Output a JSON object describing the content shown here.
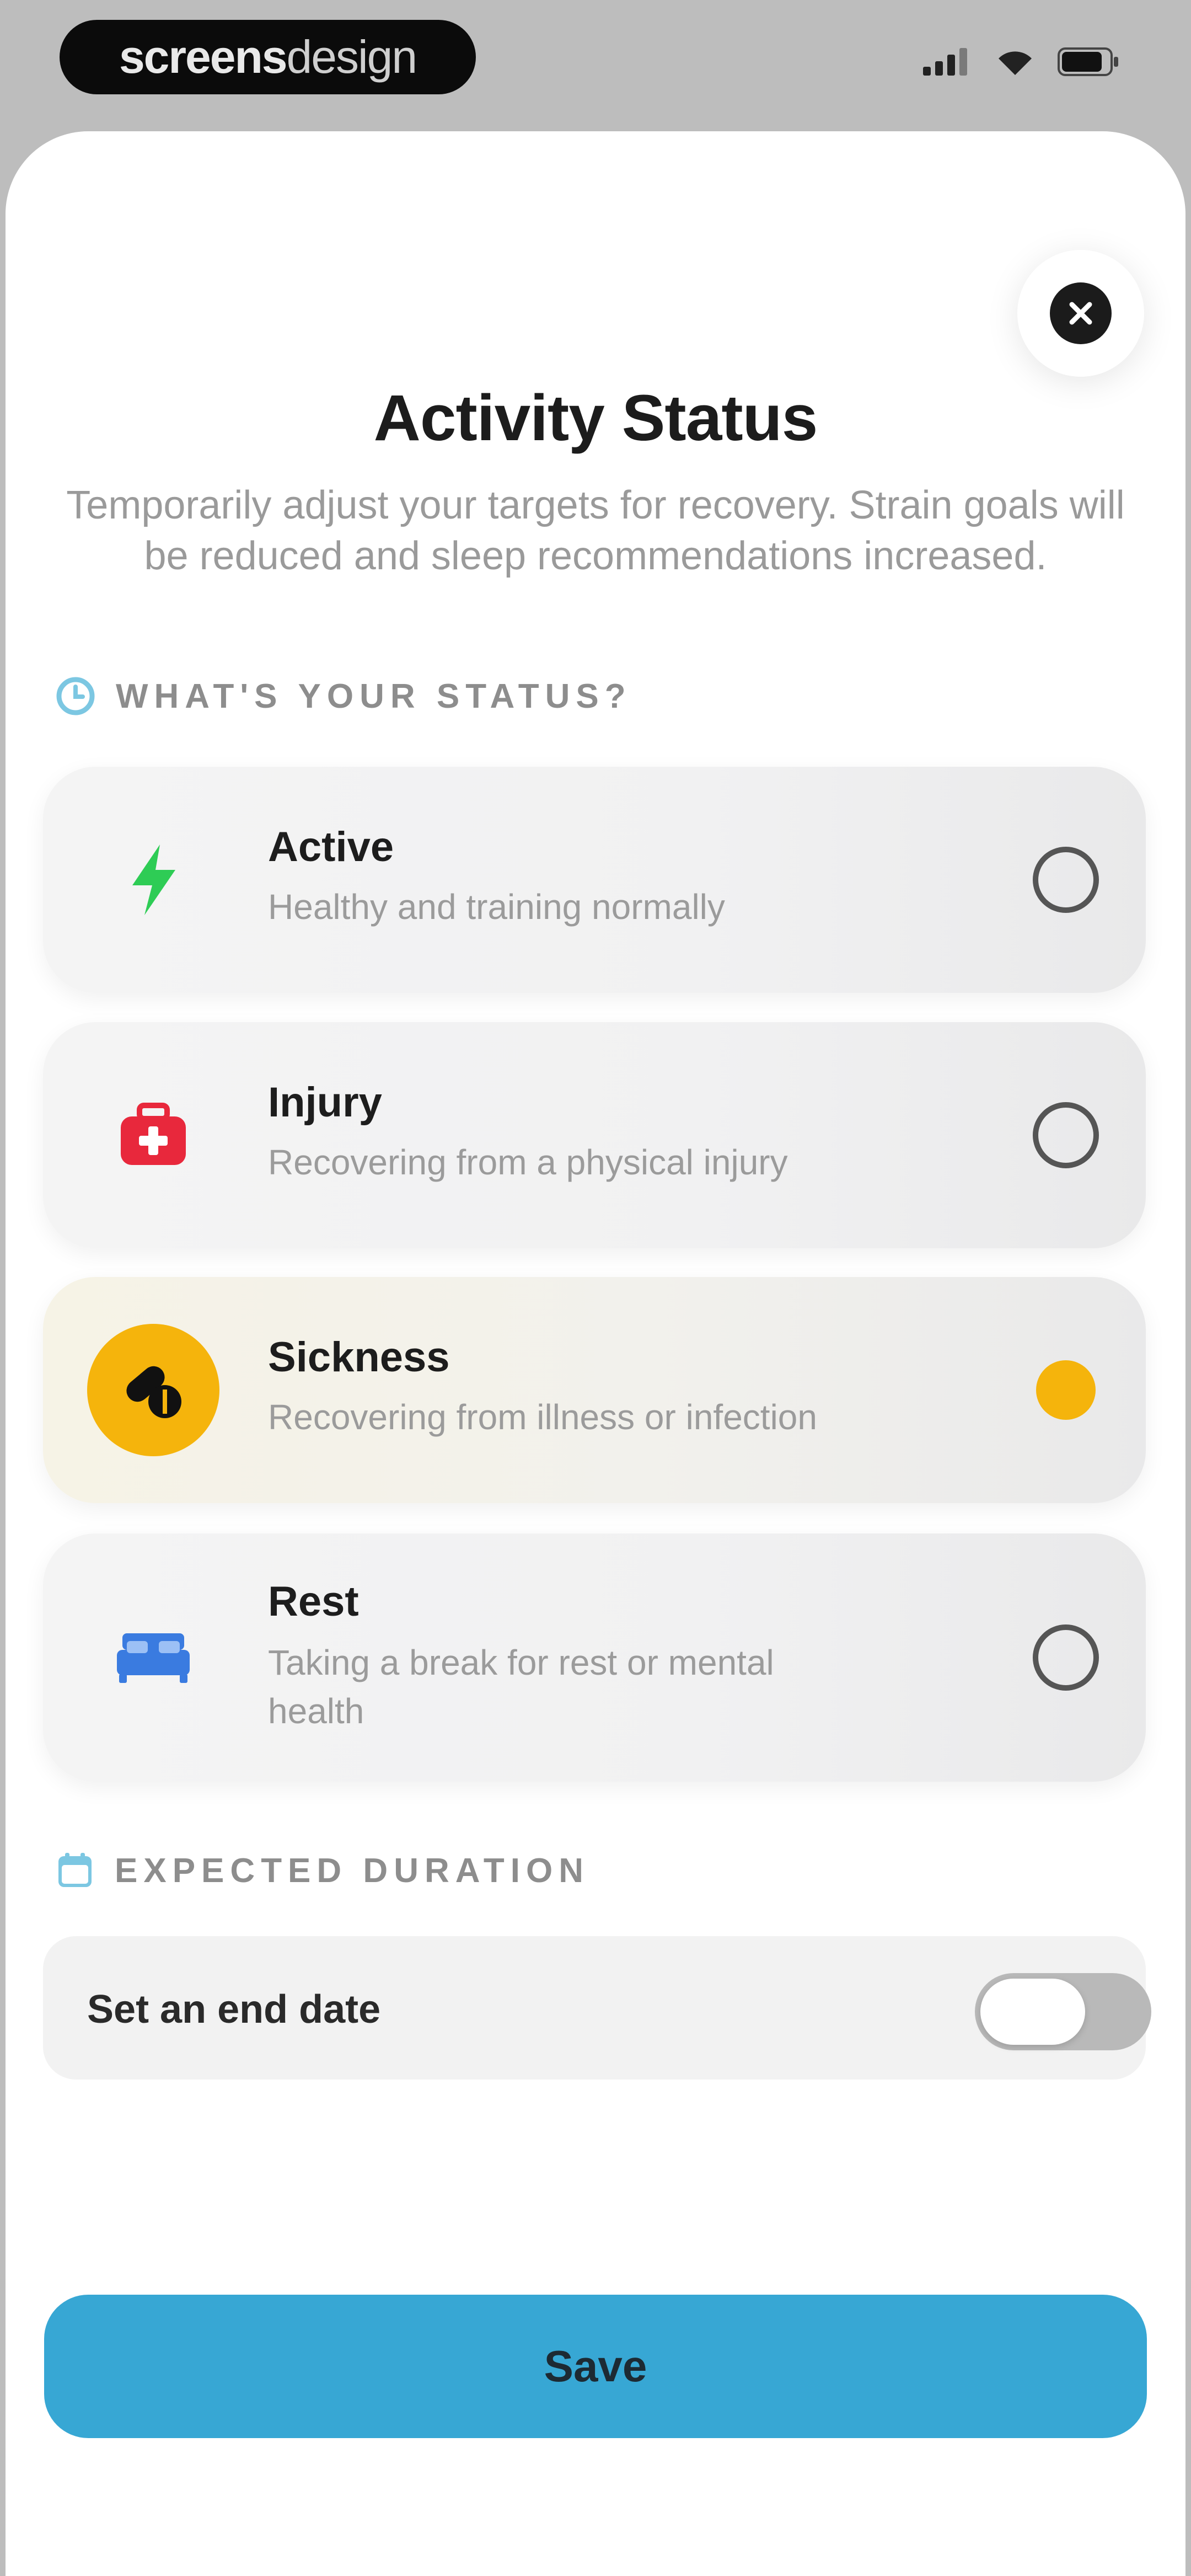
{
  "status_bar": {
    "brand_bold": "screens",
    "brand_light": "design",
    "icons": [
      "signal-icon",
      "wifi-icon",
      "battery-icon"
    ]
  },
  "sheet": {
    "close_icon": "close-icon",
    "title": "Activity Status",
    "subtitle": "Temporarily adjust your targets for recovery. Strain goals will be reduced and sleep recommendations increased."
  },
  "status_section": {
    "label": "WHAT'S YOUR STATUS?",
    "icon": "clock-icon",
    "options": [
      {
        "title": "Active",
        "description": "Healthy and training normally",
        "icon": "lightning-icon",
        "selected": false
      },
      {
        "title": "Injury",
        "description": "Recovering from a physical injury",
        "icon": "first-aid-kit-icon",
        "selected": false
      },
      {
        "title": "Sickness",
        "description": "Recovering from illness or infection",
        "icon": "pills-icon",
        "selected": true
      },
      {
        "title": "Rest",
        "description": "Taking a break for rest or mental health",
        "icon": "bed-icon",
        "selected": false
      }
    ]
  },
  "duration_section": {
    "label": "EXPECTED DURATION",
    "icon": "calendar-icon",
    "toggle_label": "Set an end date",
    "toggle_on": false
  },
  "actions": {
    "save_label": "Save"
  },
  "colors": {
    "accent": "#37a7d4",
    "selected": "#f5b40c",
    "active_green": "#2ecc55",
    "injury_red": "#e8283c",
    "rest_blue": "#3a7be0"
  }
}
